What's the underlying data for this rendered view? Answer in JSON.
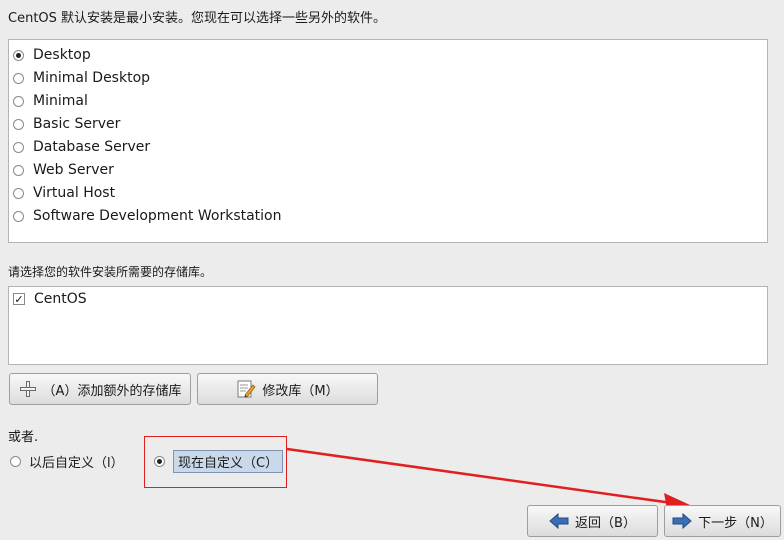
{
  "intro_text": "CentOS 默认安装是最小安装。您现在可以选择一些另外的软件。",
  "install_types": [
    {
      "label": "Desktop",
      "selected": true
    },
    {
      "label": "Minimal Desktop",
      "selected": false
    },
    {
      "label": "Minimal",
      "selected": false
    },
    {
      "label": "Basic Server",
      "selected": false
    },
    {
      "label": "Database Server",
      "selected": false
    },
    {
      "label": "Web Server",
      "selected": false
    },
    {
      "label": "Virtual Host",
      "selected": false
    },
    {
      "label": "Software Development Workstation",
      "selected": false
    }
  ],
  "repo_prompt": "请选择您的软件安装所需要的存储库。",
  "repositories": [
    {
      "label": "CentOS",
      "checked": true
    }
  ],
  "repo_buttons": {
    "add_label": "（A）添加额外的存储库",
    "modify_label": "修改库（M）"
  },
  "or_label": "或者.",
  "customize": {
    "later_label": "以后自定义（l）",
    "now_label": "现在自定义（C）",
    "selected": "now"
  },
  "nav": {
    "back_label": "返回（B）",
    "next_label": "下一步（N）"
  },
  "annotation_color": "#e02020"
}
